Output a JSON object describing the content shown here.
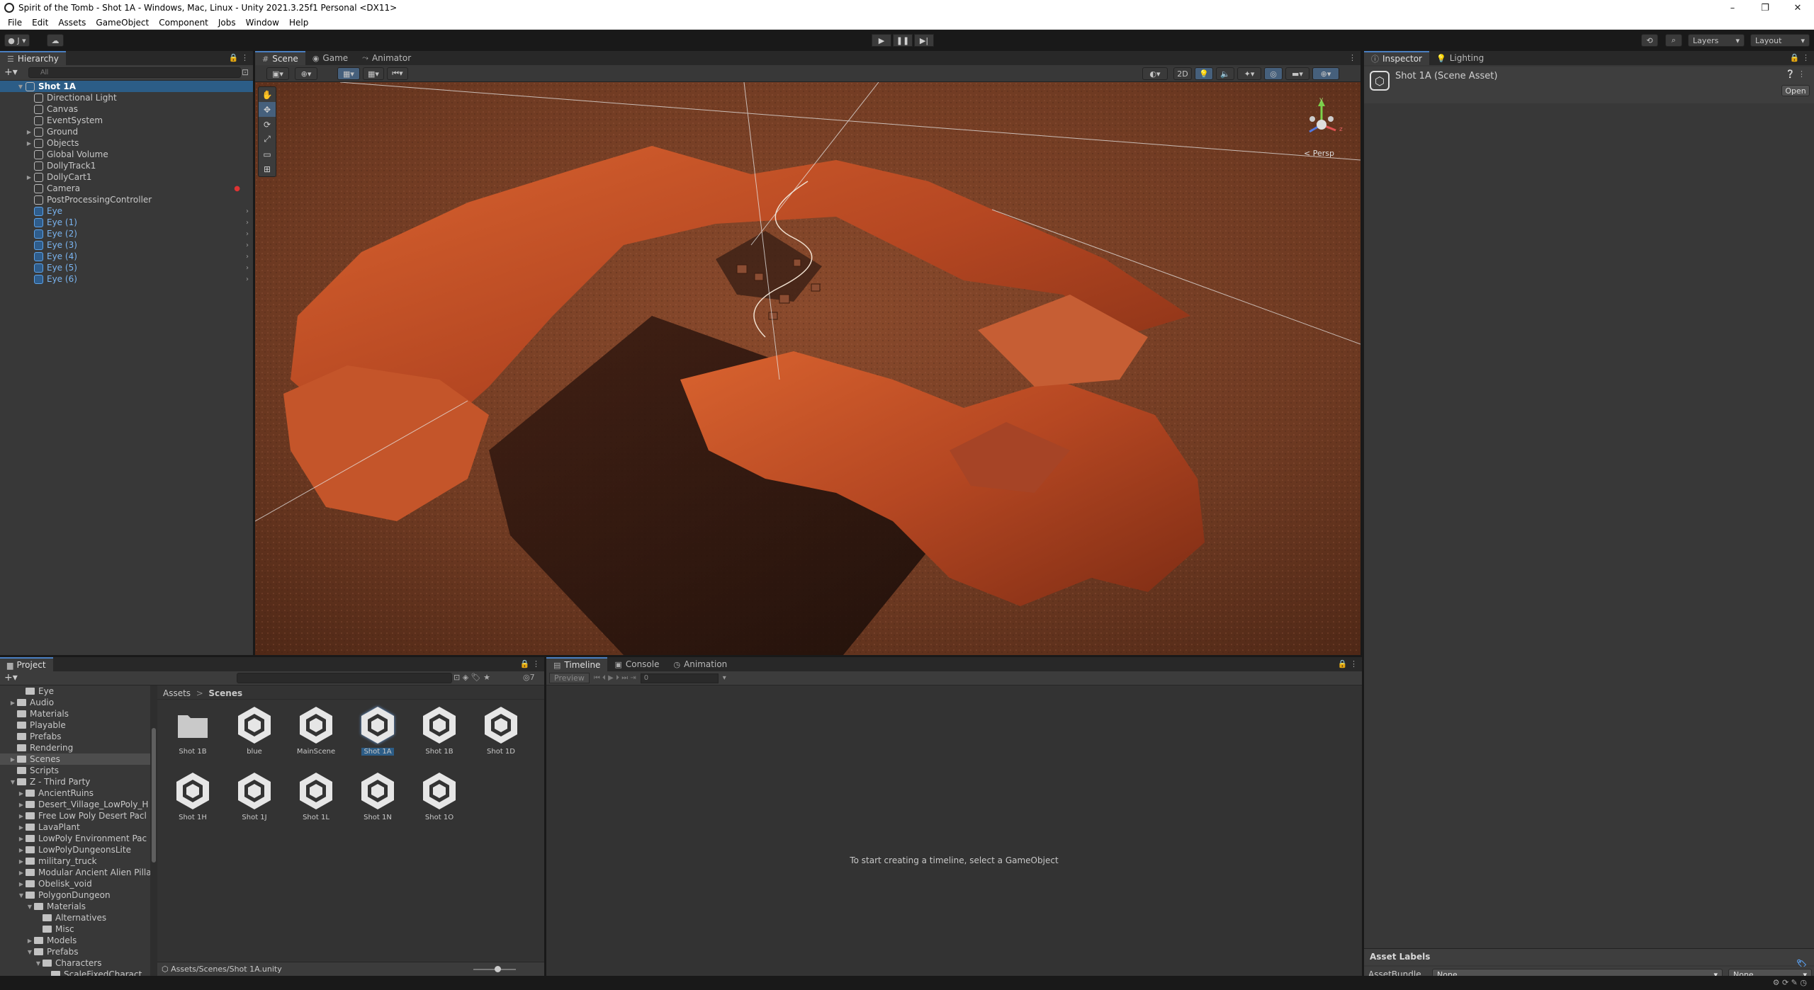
{
  "window": {
    "title": "Spirit of the Tomb - Shot 1A - Windows, Mac, Linux - Unity 2021.3.25f1 Personal <DX11>",
    "controls": [
      "–",
      "❐",
      "✕"
    ]
  },
  "menu": [
    "File",
    "Edit",
    "Assets",
    "GameObject",
    "Component",
    "Jobs",
    "Window",
    "Help"
  ],
  "toolbar": {
    "account_label": "J",
    "layers_label": "Layers",
    "layout_label": "Layout"
  },
  "hierarchy": {
    "tab": "Hierarchy",
    "search_placeholder": "All",
    "items": [
      {
        "label": "Shot 1A",
        "type": "scene"
      },
      {
        "label": "Directional Light",
        "type": "go"
      },
      {
        "label": "Canvas",
        "type": "go"
      },
      {
        "label": "EventSystem",
        "type": "go"
      },
      {
        "label": "Ground",
        "type": "go",
        "expandable": true
      },
      {
        "label": "Objects",
        "type": "go",
        "expandable": true
      },
      {
        "label": "Global Volume",
        "type": "go"
      },
      {
        "label": "DollyTrack1",
        "type": "go"
      },
      {
        "label": "DollyCart1",
        "type": "go",
        "expandable": true
      },
      {
        "label": "Camera",
        "type": "go"
      },
      {
        "label": "PostProcessingController",
        "type": "go"
      },
      {
        "label": "Eye",
        "type": "prefab"
      },
      {
        "label": "Eye (1)",
        "type": "prefab"
      },
      {
        "label": "Eye (2)",
        "type": "prefab"
      },
      {
        "label": "Eye (3)",
        "type": "prefab"
      },
      {
        "label": "Eye (4)",
        "type": "prefab"
      },
      {
        "label": "Eye (5)",
        "type": "prefab"
      },
      {
        "label": "Eye (6)",
        "type": "prefab"
      }
    ]
  },
  "scene": {
    "tabs": [
      "Scene",
      "Game",
      "Animator"
    ],
    "toggle_2d": "2D",
    "persp_label": "< Persp",
    "axis_labels": {
      "y": "y",
      "z": "z"
    }
  },
  "inspector": {
    "tabs": [
      "Inspector",
      "Lighting"
    ],
    "asset_title": "Shot 1A (Scene Asset)",
    "open_button": "Open",
    "asset_labels": "Asset Labels",
    "assetbundle_label": "AssetBundle",
    "assetbundle_value": "None",
    "assetbundle_variant": "None"
  },
  "project": {
    "tab": "Project",
    "hidden_count": "7",
    "tree": [
      {
        "label": "Eye",
        "depth": 2
      },
      {
        "label": "Audio",
        "depth": 1,
        "expandable": true
      },
      {
        "label": "Materials",
        "depth": 1
      },
      {
        "label": "Playable",
        "depth": 1
      },
      {
        "label": "Prefabs",
        "depth": 1
      },
      {
        "label": "Rendering",
        "depth": 1
      },
      {
        "label": "Scenes",
        "depth": 1,
        "selected": true,
        "expandable": true
      },
      {
        "label": "Scripts",
        "depth": 1
      },
      {
        "label": "Z - Third Party",
        "depth": 1,
        "open": true
      },
      {
        "label": "AncientRuins",
        "depth": 2,
        "expandable": true
      },
      {
        "label": "Desert_Village_LowPoly_H",
        "depth": 2,
        "expandable": true
      },
      {
        "label": "Free Low Poly Desert Pacl",
        "depth": 2,
        "expandable": true
      },
      {
        "label": "LavaPlant",
        "depth": 2,
        "expandable": true
      },
      {
        "label": "LowPoly Environment Pac",
        "depth": 2,
        "expandable": true
      },
      {
        "label": "LowPolyDungeonsLite",
        "depth": 2,
        "expandable": true
      },
      {
        "label": "military_truck",
        "depth": 2,
        "expandable": true
      },
      {
        "label": "Modular Ancient Alien Pilla",
        "depth": 2,
        "expandable": true
      },
      {
        "label": "Obelisk_void",
        "depth": 2,
        "expandable": true
      },
      {
        "label": "PolygonDungeon",
        "depth": 2,
        "open": true
      },
      {
        "label": "Materials",
        "depth": 3,
        "open": true
      },
      {
        "label": "Alternatives",
        "depth": 4
      },
      {
        "label": "Misc",
        "depth": 4
      },
      {
        "label": "Models",
        "depth": 3,
        "expandable": true
      },
      {
        "label": "Prefabs",
        "depth": 3,
        "open": true
      },
      {
        "label": "Characters",
        "depth": 4,
        "open": true
      },
      {
        "label": "ScaleFixedCharact",
        "depth": 5
      }
    ],
    "breadcrumb": [
      "Assets",
      "Scenes"
    ],
    "assets": [
      {
        "label": "Shot 1B",
        "kind": "folder"
      },
      {
        "label": "blue",
        "kind": "scene"
      },
      {
        "label": "MainScene",
        "kind": "scene"
      },
      {
        "label": "Shot 1A",
        "kind": "scene",
        "selected": true
      },
      {
        "label": "Shot 1B",
        "kind": "scene"
      },
      {
        "label": "Shot 1D",
        "kind": "scene"
      },
      {
        "label": "Shot 1H",
        "kind": "scene"
      },
      {
        "label": "Shot 1J",
        "kind": "scene"
      },
      {
        "label": "Shot 1L",
        "kind": "scene"
      },
      {
        "label": "Shot 1N",
        "kind": "scene"
      },
      {
        "label": "Shot 1O",
        "kind": "scene"
      }
    ],
    "status_path": "Assets/Scenes/Shot 1A.unity"
  },
  "timeline": {
    "tabs": [
      "Timeline",
      "Console",
      "Animation"
    ],
    "preview_label": "Preview",
    "frame_value": "0",
    "empty_message": "To start creating a timeline, select a GameObject"
  }
}
